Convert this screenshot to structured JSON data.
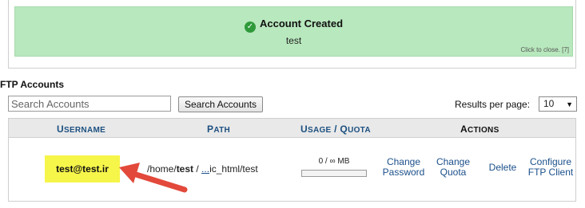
{
  "notice": {
    "title": "Account Created",
    "username": "test",
    "close_text": "Click to close. [7]"
  },
  "section_title": "FTP Accounts",
  "search": {
    "placeholder": "Search Accounts",
    "button_label": "Search Accounts"
  },
  "results_per_page": {
    "label": "Results per page:",
    "value": "10"
  },
  "table": {
    "headers": {
      "username_first": "U",
      "username_rest": "SERNAME",
      "path_first": "P",
      "path_rest": "ATH",
      "usage_first": "U",
      "usage_rest": "SAGE",
      "slash": " / ",
      "quota_first": "Q",
      "quota_rest": "UOTA",
      "actions_first": "A",
      "actions_rest": "CTIONS"
    },
    "rows": [
      {
        "username": "test@test.ir",
        "path_prefix": "/home/",
        "path_user": "test",
        "path_sep": " /",
        "path_link": "...",
        "path_rest": "ic_html/test",
        "usage_text": "0 / ∞ MB",
        "usage_fraction": 0,
        "actions": {
          "change_password_1": "Change",
          "change_password_2": "Password",
          "change_quota_1": "Change",
          "change_quota_2": "Quota",
          "delete": "Delete",
          "configure_1": "Configure",
          "configure_2": "FTP Client"
        }
      }
    ]
  },
  "colors": {
    "success_bg": "#b8e8bd",
    "highlight": "#f6f54a",
    "arrow": "#e2493b",
    "link": "#1a4f8a"
  },
  "icons": [
    "check-circle-icon",
    "chevron-down-icon",
    "red-arrow-annotation"
  ]
}
